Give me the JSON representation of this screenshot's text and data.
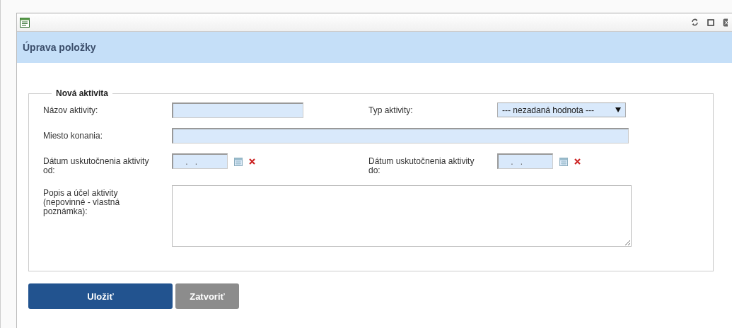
{
  "window": {
    "title": "Úprava položky"
  },
  "form": {
    "legend": "Nová aktivita",
    "name": {
      "label": "Názov aktivity:"
    },
    "type": {
      "label": "Typ aktivity:",
      "value": "--- nezadaná hodnota ---"
    },
    "place": {
      "label": "Miesto konania:"
    },
    "date_from": {
      "label": "Dátum uskutočnenia aktivity od:",
      "value": ".   ."
    },
    "date_to": {
      "label": "Dátum uskutočnenia aktivity do:",
      "value": ".   ."
    },
    "description": {
      "label": "Popis a účel aktivity (nepovinné - vlastná poznámka):"
    }
  },
  "buttons": [
    {
      "label": "Uložiť",
      "kind": "primary"
    },
    {
      "label": "Zatvoriť",
      "kind": "secondary"
    }
  ]
}
